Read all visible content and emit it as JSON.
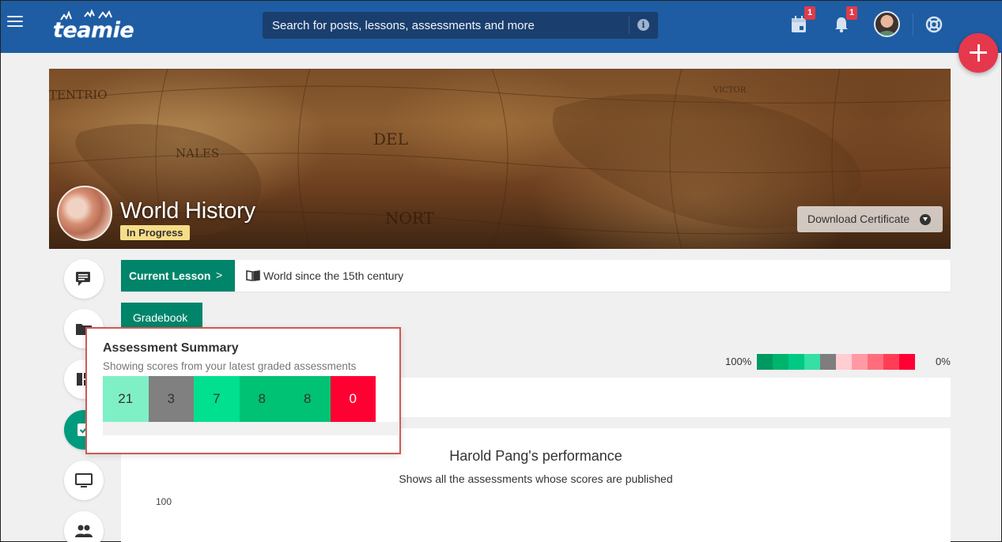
{
  "header": {
    "logo_text": "teamie",
    "search_placeholder": "Search for posts, lessons, assessments and more",
    "calendar_badge": "1",
    "notifications_badge": "1"
  },
  "course": {
    "title": "World History",
    "status": "In Progress",
    "download_label": "Download Certificate",
    "map_words": [
      "TENTRIO",
      "NALES",
      "DEL",
      "NORT",
      "VICTOR"
    ]
  },
  "lesson": {
    "current_label": "Current Lesson",
    "chevron": ">",
    "title": "World since the 15th century"
  },
  "tabs": {
    "gradebook": "Gradebook"
  },
  "scale": {
    "high_label": "100%",
    "low_label": "0%",
    "colors": [
      "#009962",
      "#00b46d",
      "#00c983",
      "#36dfa3",
      "#7e7e7e",
      "#ffcdd2",
      "#ff9aa5",
      "#ff6d7d",
      "#ff3e55",
      "#ff0033"
    ]
  },
  "summary": {
    "title": "Assessment Summary",
    "subtitle": "Showing scores from your latest graded assessments",
    "scores": [
      {
        "value": "21",
        "color": "#7ff0c6"
      },
      {
        "value": "3",
        "color": "#808080"
      },
      {
        "value": "7",
        "color": "#00e08e"
      },
      {
        "value": "8",
        "color": "#00c274"
      },
      {
        "value": "8",
        "color": "#00c274"
      },
      {
        "value": "0",
        "color": "#ff0033",
        "text_color": "#ffffff"
      }
    ]
  },
  "performance": {
    "title": "Harold Pang's performance",
    "subtitle": "Shows all the assessments whose scores are published",
    "y_top_label": "100"
  },
  "colors": {
    "header": "#1e5da3",
    "accent": "#00856a",
    "fab": "#e5384d"
  }
}
